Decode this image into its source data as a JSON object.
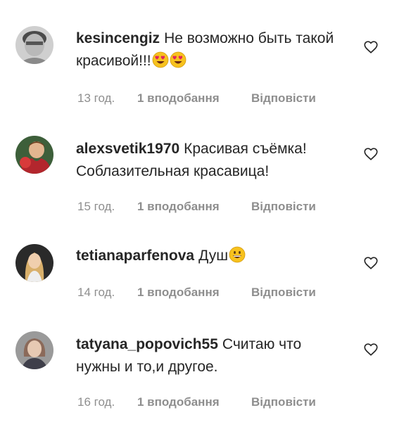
{
  "comments": [
    {
      "username": "kesincengiz",
      "text": "Не возможно быть такой красивой!!!",
      "emoji": [
        "heart-eyes",
        "heart-eyes"
      ],
      "time": "13 год.",
      "likes": "1 вподобання",
      "reply": "Відповісти"
    },
    {
      "username": "alexsvetik1970",
      "text": "Красивая съёмка! Соблазительная красавица!",
      "emoji": [],
      "time": "15 год.",
      "likes": "1 вподобання",
      "reply": "Відповісти"
    },
    {
      "username": "tetianaparfenova",
      "text": "Душ",
      "emoji": [
        "grinning"
      ],
      "time": "14 год.",
      "likes": "1 вподобання",
      "reply": "Відповісти"
    },
    {
      "username": "tatyana_popovich55",
      "text": "Считаю что нужны и то,и другое.",
      "emoji": [],
      "time": "16 год.",
      "likes": "1 вподобання",
      "reply": "Відповісти"
    }
  ],
  "colors": {
    "text": "#262626",
    "muted": "#8e8e8e",
    "emoji_face": "#f7c21e"
  }
}
